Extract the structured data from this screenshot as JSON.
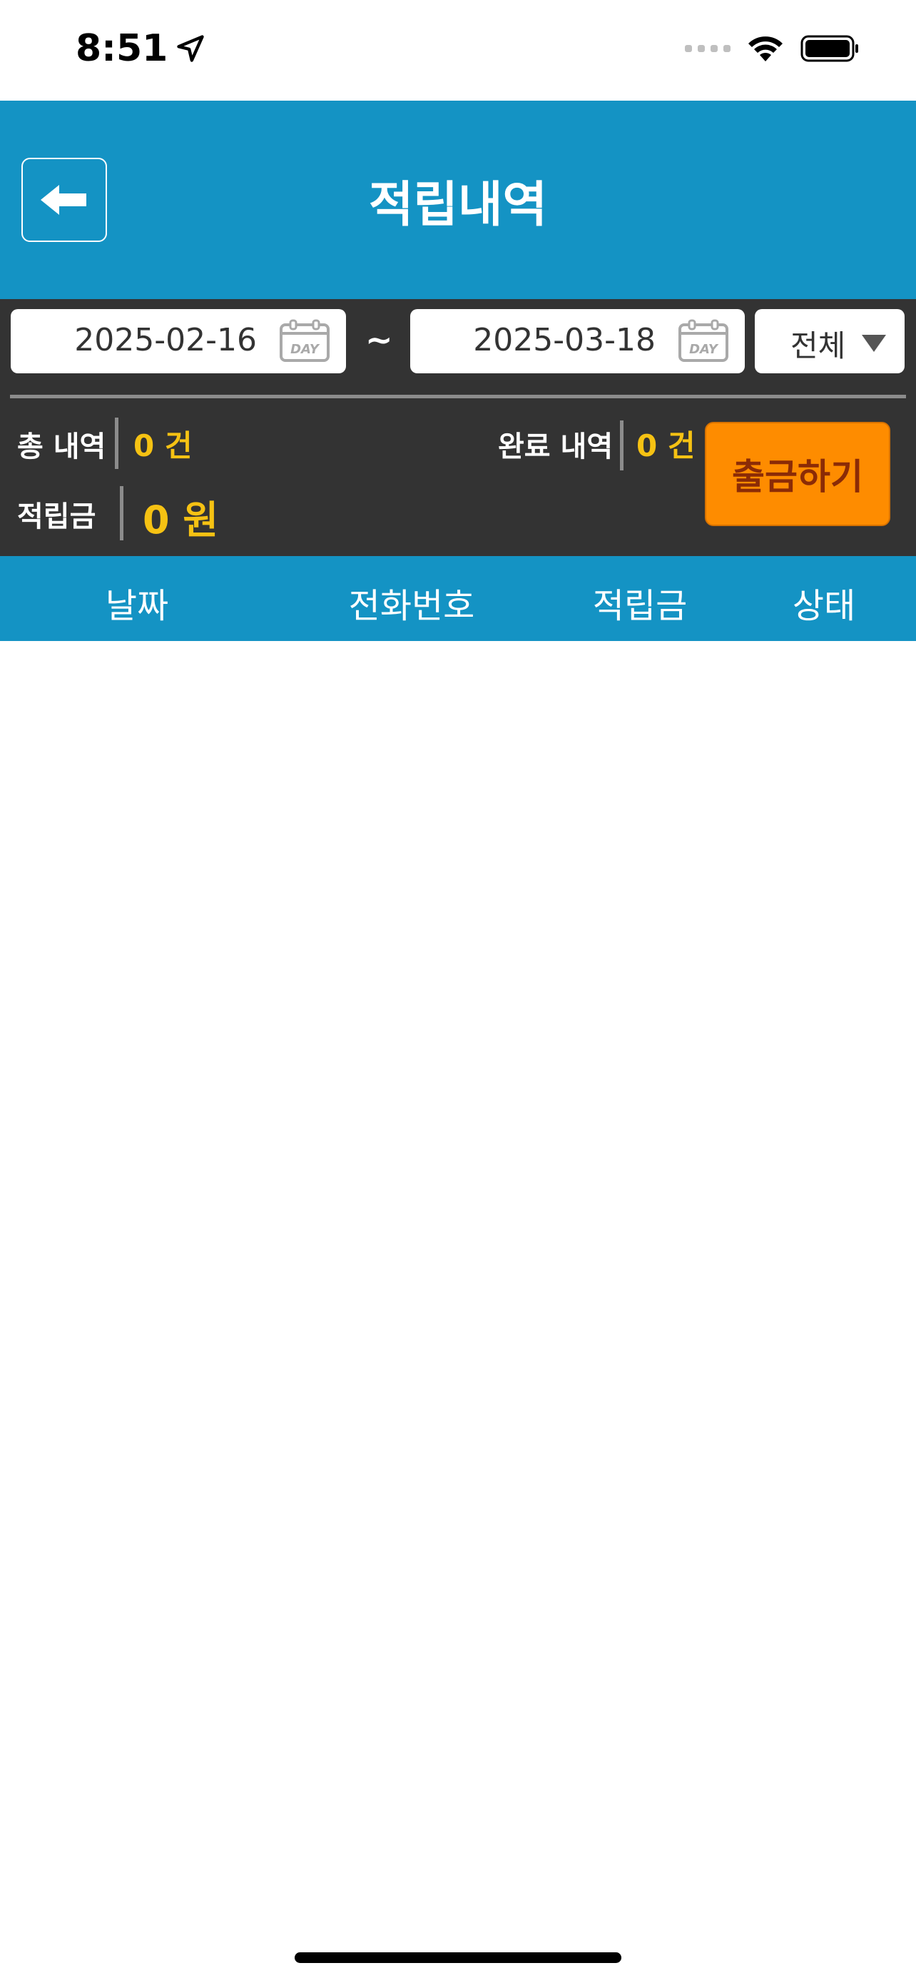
{
  "status_bar": {
    "time": "8:51",
    "icons": [
      "location-arrow-icon",
      "cellular-signal-icon",
      "wifi-icon",
      "battery-icon"
    ]
  },
  "header": {
    "title": "적립내역",
    "back_icon": "arrow-left-icon",
    "background": "#1493c4"
  },
  "filter": {
    "start_date": "2025-02-16",
    "end_date": "2025-03-18",
    "separator": "~",
    "calendar_icon": "calendar-day-icon",
    "status_select": "전체"
  },
  "summary": {
    "total_label": "총 내역",
    "total_value": "0 건",
    "completed_label": "완료 내역",
    "completed_value": "0 건",
    "points_label": "적립금",
    "points_value": "0 원",
    "withdraw_button": "출금하기"
  },
  "table": {
    "columns": [
      "날짜",
      "전화번호",
      "적립금",
      "상태"
    ],
    "rows": []
  },
  "colors": {
    "primary": "#1493c4",
    "panel": "#333333",
    "accent_value": "#f6c213",
    "button": "#fe8c00"
  }
}
